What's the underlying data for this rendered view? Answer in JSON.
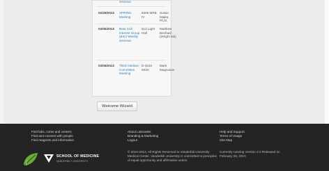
{
  "table": {
    "rows": [
      {
        "date": "",
        "title": "Seminar",
        "location": "",
        "people": ""
      },
      {
        "date": "02/28/2013",
        "title": "SPRING Meeting",
        "location": "8405 MRB IV",
        "people": "Susan Majka, Ph.D."
      },
      {
        "date": "03/06/2013",
        "title": "Beta Cell Interest Group (BIG) Weekly Seminar",
        "location": "512 Light Hall",
        "people": "Matthew Bechard (Wright lab)"
      },
      {
        "date": "03/08/2013",
        "title": "Third Adelson Committee Meeting",
        "location": "D-3243 MCN",
        "people": "Mark Magnuson"
      }
    ]
  },
  "buttons": {
    "welcome": "Welcome Wizard"
  },
  "footer": {
    "col1": [
      "Find labs, cores and centers",
      "Find and connect with people",
      "Find reagents and information"
    ],
    "col2": [
      "About Labnodes",
      "Branding & Marketing",
      "Logout"
    ],
    "col3": [
      "Help and Support",
      "Terms of Usage",
      "Site Map"
    ],
    "legal": "© 2010-2013, All Rights Reserved to Vanderbilt University Medical Center. Vanderbilt University is committed to principles of equal opportunity and affirmative action.",
    "version": "Currently running Version 2.0 Released on February 26, 2013",
    "logo_text": "SCHOOL OF MEDICINE",
    "logo_sub": "VANDERBILT UNIVERSITY"
  },
  "colors": {
    "link": "#2f7fb3",
    "footer_bg": "#242424",
    "leaf_green": "#6cab3c"
  }
}
